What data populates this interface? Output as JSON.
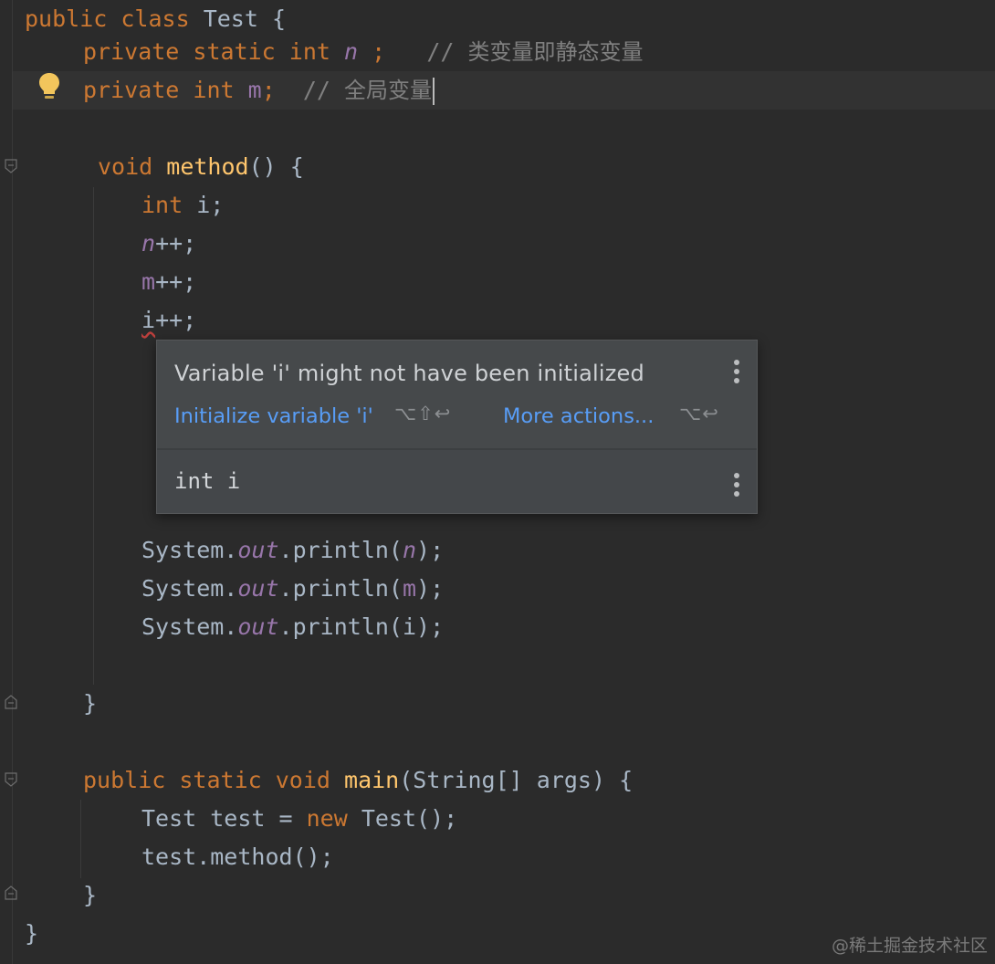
{
  "code": {
    "line1": {
      "kw1": "public",
      "kw2": "class",
      "name": "Test {"
    },
    "line2": {
      "kw1": "private",
      "kw2": "static",
      "kw3": "int",
      "field": "n",
      "semi": " ;",
      "comment_slashes": "// ",
      "comment_text": "类变量即静态变量"
    },
    "line3": {
      "kw1": "private",
      "kw2": "int",
      "field": "m",
      "semi": ";",
      "comment_slashes": "// ",
      "comment_text": "全局变量"
    },
    "line5": {
      "kw1": "void",
      "fn": "method",
      "rest": "() {"
    },
    "line6": {
      "kw": "int",
      "rest": " i;"
    },
    "line7": {
      "var": "n",
      "rest": "++;"
    },
    "line8": {
      "var": "m",
      "rest": "++;"
    },
    "line9": {
      "var": "i",
      "rest": "++;"
    },
    "line14": {
      "obj": "System.",
      "field": "out",
      "call": ".println(",
      "arg": "n",
      "close": ");"
    },
    "line15": {
      "obj": "System.",
      "field": "out",
      "call": ".println(",
      "arg": "m",
      "close": ");"
    },
    "line16": {
      "obj": "System.",
      "field": "out",
      "call": ".println(",
      "arg": "i",
      "close": ");"
    },
    "line18": {
      "text": "}"
    },
    "line20": {
      "kw1": "public",
      "kw2": "static",
      "kw3": "void",
      "fn": "main",
      "rest": "(String[] args) {"
    },
    "line21": {
      "type": "Test test = ",
      "kw": "new",
      "rest": " Test();"
    },
    "line22": {
      "text": "test.method();"
    },
    "line23": {
      "text": "}"
    },
    "line24": {
      "text": "}"
    }
  },
  "popup": {
    "message": "Variable 'i' might not have been initialized",
    "action_label": "Initialize variable 'i'",
    "action_shortcut": "⌥⇧↩",
    "more_label": "More actions...",
    "more_shortcut": "⌥↩",
    "declaration": "int i"
  },
  "icons": {
    "bulb": "lightbulb-icon",
    "fold": "fold-marker-icon",
    "kebab": "more-vertical-icon"
  },
  "colors": {
    "background": "#2b2b2b",
    "keyword": "#cc7832",
    "method": "#ffc66d",
    "field": "#9876aa",
    "default": "#a9b7c6",
    "comment": "#808080",
    "link": "#589df6",
    "popup_bg": "#46494b"
  },
  "watermark": "@稀土掘金技术社区"
}
